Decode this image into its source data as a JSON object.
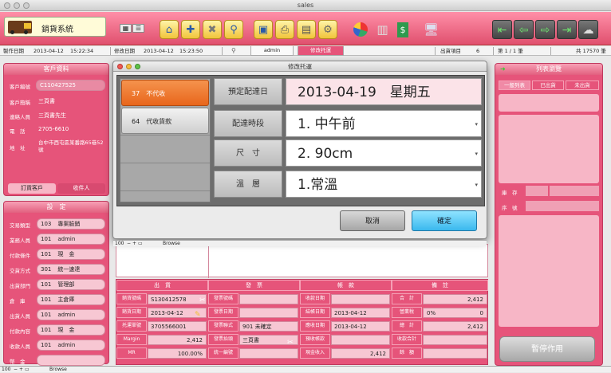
{
  "window": {
    "title": "sales"
  },
  "app": {
    "name": "銷貨系統"
  },
  "status": {
    "created_label": "製作日期",
    "created_date": "2013-04-12",
    "created_time": "15:22:34",
    "modified_label": "修改日期",
    "modified_date": "2013-04-12",
    "modified_time": "15:23:50",
    "user_tab": "admin",
    "mode_tab": "修改托運",
    "items_label": "出貨項目",
    "items_value": "6",
    "page": "第 1 / 1 筆",
    "total": "共 17570 筆"
  },
  "customer": {
    "header": "客戶資料",
    "fields": [
      {
        "label": "客戶編號",
        "value": "C110427525"
      },
      {
        "label": "客戶簡稱",
        "value": "三頁書"
      },
      {
        "label": "連絡人員",
        "value": "三頁書先生"
      },
      {
        "label": "電　話",
        "value": "2705-6610"
      },
      {
        "label": "地　址",
        "value": "台中市西屯區某番路65巷52號"
      }
    ],
    "tab_active": "訂貨客戶",
    "tab_other": "收件人"
  },
  "settings": {
    "header": "設　定",
    "rows": [
      {
        "label": "交易類型",
        "code": "103",
        "value": "專案臉銷"
      },
      {
        "label": "業務人員",
        "code": "101",
        "value": "admin"
      },
      {
        "label": "付款條件",
        "code": "101",
        "value": "現　金"
      },
      {
        "label": "交貨方式",
        "code": "301",
        "value": "統一速達"
      },
      {
        "label": "出貨部門",
        "code": "101",
        "value": "管理部"
      },
      {
        "label": "倉　庫",
        "code": "101",
        "value": "主倉庫"
      },
      {
        "label": "出貨人員",
        "code": "101",
        "value": "admin"
      },
      {
        "label": "付款內容",
        "code": "101",
        "value": "現　金"
      },
      {
        "label": "收款人員",
        "code": "101",
        "value": "admin"
      },
      {
        "label": "幣　金",
        "code": "",
        "value": ""
      }
    ]
  },
  "bottom": {
    "headers": [
      "出　貨",
      "發　票",
      "帳　款",
      "備　註"
    ],
    "ship": [
      {
        "label": "銷貨號碼",
        "value": "S130412578"
      },
      {
        "label": "銷貨日期",
        "value": "2013-04-12"
      },
      {
        "label": "托運單號",
        "value": "3705566001"
      },
      {
        "label": "Margin",
        "value": "2,412"
      },
      {
        "label": "MR",
        "value": "100.00%"
      }
    ],
    "invoice": [
      {
        "label": "發票號碼",
        "value": ""
      },
      {
        "label": "發票日期",
        "value": ""
      },
      {
        "label": "發票聯式",
        "value": "901 未確定"
      },
      {
        "label": "發票抬頭",
        "value": "三頁書"
      },
      {
        "label": "統一編號",
        "value": ""
      }
    ],
    "account": [
      {
        "label": "收款日期",
        "value": ""
      },
      {
        "label": "結帳日期",
        "value": "2013-04-12"
      },
      {
        "label": "應收日期",
        "value": "2013-04-12"
      },
      {
        "label": "預收帳款",
        "value": ""
      },
      {
        "label": "現金收入",
        "value": "2,412"
      }
    ],
    "totals": [
      {
        "label": "合　計",
        "value": "2,412"
      },
      {
        "label": "營業稅",
        "tax_rate": "0%",
        "value": "0"
      },
      {
        "label": "總　計",
        "value": "2,412"
      },
      {
        "label": "收款合計",
        "value": ""
      },
      {
        "label": "餘　額",
        "value": ""
      }
    ]
  },
  "right_panel": {
    "header": "列表瀏覽",
    "tabs": [
      "一般列表",
      "已出貨",
      "未出貨"
    ],
    "stock_label": "庫　存",
    "serial_label": "序　號",
    "pause_button": "暫停作用"
  },
  "dialog": {
    "title": "修改托運",
    "options": [
      {
        "code": "37",
        "label": "不代收",
        "selected": true
      },
      {
        "code": "64",
        "label": "代收貨款",
        "selected": false
      }
    ],
    "fields": [
      {
        "label": "預定配達日",
        "value": "2013-04-19　星期五"
      },
      {
        "label": "配達時段",
        "value": "1. 中午前"
      },
      {
        "label": "尺　寸",
        "value": "2. 90cm"
      },
      {
        "label": "溫　層",
        "value": "1.常溫"
      }
    ],
    "cancel": "取消",
    "confirm": "確定",
    "zoom": "100",
    "mode": "Browse"
  },
  "main_statusbar": {
    "zoom": "100",
    "mode": "Browse"
  }
}
